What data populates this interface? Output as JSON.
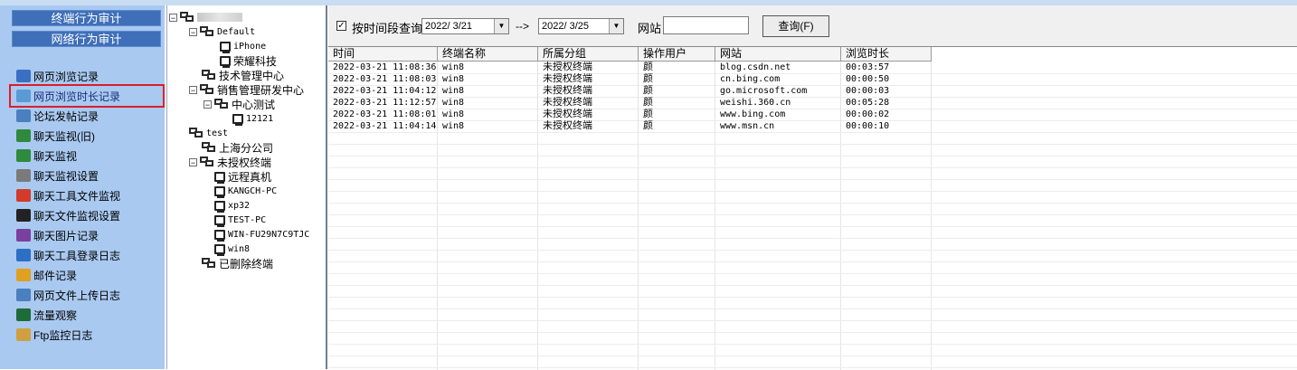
{
  "sidebar": {
    "top_buttons": [
      "终端行为审计",
      "网络行为审计"
    ],
    "items": [
      {
        "label": "网页浏览记录",
        "icon": "web-page-icon",
        "color": "#3a6fc4"
      },
      {
        "label": "网页浏览时长记录",
        "icon": "web-time-icon",
        "color": "#5b9bd5",
        "selected": true
      },
      {
        "label": "论坛发帖记录",
        "icon": "forum-icon",
        "color": "#4a7fc0"
      },
      {
        "label": "聊天监视(旧)",
        "icon": "chat-monitor-icon",
        "color": "#2d8a3e"
      },
      {
        "label": "聊天监视",
        "icon": "chat-monitor-icon",
        "color": "#2d8a3e"
      },
      {
        "label": "聊天监视设置",
        "icon": "chat-settings-icon",
        "color": "#7a7a7a"
      },
      {
        "label": "聊天工具文件监视",
        "icon": "chat-file-icon",
        "color": "#d23a2a"
      },
      {
        "label": "聊天文件监视设置",
        "icon": "qq-icon",
        "color": "#222222"
      },
      {
        "label": "聊天图片记录",
        "icon": "image-icon",
        "color": "#7b3fa0"
      },
      {
        "label": "聊天工具登录日志",
        "icon": "login-log-icon",
        "color": "#2d6fc4"
      },
      {
        "label": "邮件记录",
        "icon": "mail-icon",
        "color": "#e0a020"
      },
      {
        "label": "网页文件上传日志",
        "icon": "upload-icon",
        "color": "#4a7fc0"
      },
      {
        "label": "流量观察",
        "icon": "traffic-icon",
        "color": "#1f6b3a"
      },
      {
        "label": "Ftp监控日志",
        "icon": "ftp-icon",
        "color": "#d0a040"
      }
    ]
  },
  "tree": {
    "nodes": [
      {
        "label": "",
        "type": "root",
        "toggle": "⊟"
      },
      {
        "label": "Default",
        "type": "group",
        "toggle": "⊟",
        "mono": true
      },
      {
        "label": "iPhone",
        "type": "pc",
        "mono": true
      },
      {
        "label": "荣耀科技",
        "type": "pc"
      },
      {
        "label": "技术管理中心",
        "type": "group"
      },
      {
        "label": "销售管理研发中心",
        "type": "group",
        "toggle": "⊟"
      },
      {
        "label": "中心测试",
        "type": "group",
        "toggle": "⊟"
      },
      {
        "label": "12121",
        "type": "pc",
        "mono": true
      },
      {
        "label": "test",
        "type": "group",
        "mono": true
      },
      {
        "label": "上海分公司",
        "type": "group"
      },
      {
        "label": "未授权终端",
        "type": "group",
        "toggle": "⊟"
      },
      {
        "label": "远程真机",
        "type": "pc"
      },
      {
        "label": "KANGCH-PC",
        "type": "pc",
        "mono": true
      },
      {
        "label": "xp32",
        "type": "pc",
        "mono": true
      },
      {
        "label": "TEST-PC",
        "type": "pc",
        "mono": true
      },
      {
        "label": "WIN-FU29N7C9TJC",
        "type": "pc",
        "mono": true
      },
      {
        "label": "win8",
        "type": "pc",
        "mono": true
      },
      {
        "label": "已删除终端",
        "type": "group"
      }
    ]
  },
  "toolbar": {
    "checkbox_label": "按时间段查询",
    "checkbox_checked": "✓",
    "date_from": "2022/ 3/21",
    "arrow": "-->",
    "date_to": "2022/ 3/25",
    "site_label": "网站",
    "site_value": "",
    "query_button": "查询(F)"
  },
  "table": {
    "columns": [
      "时间",
      "终端名称",
      "所属分组",
      "操作用户",
      "网站",
      "浏览时长"
    ],
    "rows": [
      [
        "2022-03-21 11:08:36",
        "win8",
        "未授权终端",
        "颜",
        "blog.csdn.net",
        "00:03:57"
      ],
      [
        "2022-03-21 11:08:03",
        "win8",
        "未授权终端",
        "颜",
        "cn.bing.com",
        "00:00:50"
      ],
      [
        "2022-03-21 11:04:12",
        "win8",
        "未授权终端",
        "颜",
        "go.microsoft.com",
        "00:00:03"
      ],
      [
        "2022-03-21 11:12:57",
        "win8",
        "未授权终端",
        "颜",
        "weishi.360.cn",
        "00:05:28"
      ],
      [
        "2022-03-21 11:08:01",
        "win8",
        "未授权终端",
        "颜",
        "www.bing.com",
        "00:00:02"
      ],
      [
        "2022-03-21 11:04:14",
        "win8",
        "未授权终端",
        "颜",
        "www.msn.cn",
        "00:00:10"
      ]
    ]
  },
  "colors": {
    "sidebar_bg": "#a9c9f0",
    "header_button_bg": "#3f6fb8",
    "selection_border": "#d81f2a"
  }
}
